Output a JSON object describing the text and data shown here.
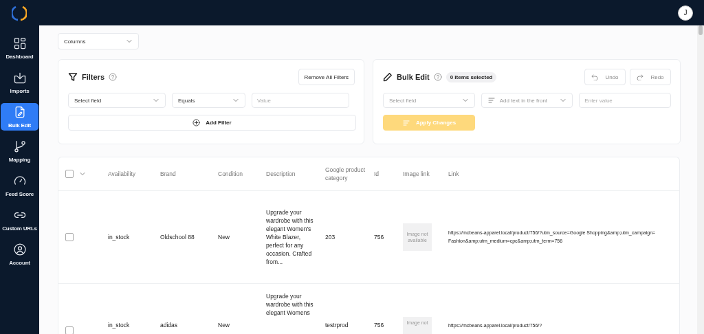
{
  "topbar": {
    "avatar": "J"
  },
  "sidebar": {
    "items": [
      {
        "label": "Dashboard",
        "selected": false
      },
      {
        "label": "Imports",
        "selected": false
      },
      {
        "label": "Bulk Edit",
        "selected": true
      },
      {
        "label": "Mapping",
        "selected": false
      },
      {
        "label": "Feed Score",
        "selected": false
      },
      {
        "label": "Custom URLs",
        "selected": false
      },
      {
        "label": "Account",
        "selected": false
      }
    ]
  },
  "columns_button": "Columns",
  "filters": {
    "title": "Filters",
    "remove_button": "Remove All Filters",
    "field_select": {
      "placeholder": "Select field"
    },
    "operator_select": "Equals",
    "value_field": {
      "placeholder": "Value"
    },
    "add_button": "Add Filter"
  },
  "bulk_edit": {
    "title": "Bulk Edit",
    "selection_badge": "0 items selected",
    "undo_button": "Undo",
    "redo_button": "Redo",
    "field_select": {
      "placeholder": "Select field"
    },
    "action_select": "Add text in the front",
    "value_field": {
      "placeholder": "Enter value"
    },
    "apply_button": {
      "label": "Apply Changes",
      "disabled": true
    }
  },
  "table": {
    "select_all_checked": false,
    "columns": [
      "Availability",
      "Brand",
      "Condition",
      "Description",
      "Google product category",
      "Id",
      "Image link",
      "Link"
    ],
    "rows": [
      {
        "checked": false,
        "availability": "in_stock",
        "brand": "Oldschool 88",
        "condition": "New",
        "description": "Upgrade your wardrobe with this elegant Women's White Blazer, perfect for any occasion. Crafted from...",
        "google_product_category": "203",
        "id": "756",
        "image_placeholder": "Image not available",
        "link": "https://mcbeans-apparel.local/product/756/?utm_source=Google Shopping&amp;utm_campaign=\nFashion&amp;utm_medium=cpc&amp;utm_term=756"
      },
      {
        "checked": false,
        "availability": "in_stock",
        "brand": "adidas",
        "condition": "New",
        "description": "Upgrade your wardrobe with this elegant Womens",
        "google_product_category": "testrprod",
        "id": "756",
        "image_placeholder": "Image not",
        "link": "https://mcbeans-apparel.local/product/756/?"
      }
    ]
  }
}
